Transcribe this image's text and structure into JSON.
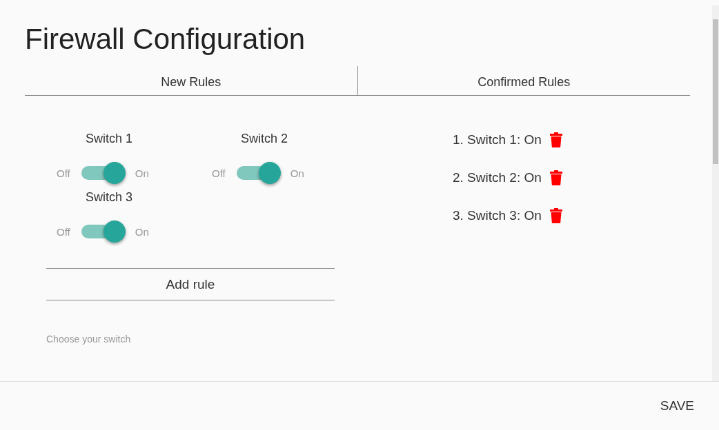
{
  "dialog": {
    "title": "Firewall Configuration"
  },
  "tabs": [
    {
      "label": "New Rules"
    },
    {
      "label": "Confirmed Rules"
    }
  ],
  "switches": [
    {
      "name": "Switch 1",
      "off_label": "Off",
      "on_label": "On",
      "on": true
    },
    {
      "name": "Switch 2",
      "off_label": "Off",
      "on_label": "On",
      "on": true
    },
    {
      "name": "Switch 3",
      "off_label": "Off",
      "on_label": "On",
      "on": true
    }
  ],
  "add_rule_button": "Add rule",
  "switch_select": {
    "label": "Choose your switch"
  },
  "confirmed_rules": [
    "1. Switch 1: On",
    "2. Switch 2: On",
    "3. Switch 3: On"
  ],
  "save_button": "SAVE"
}
